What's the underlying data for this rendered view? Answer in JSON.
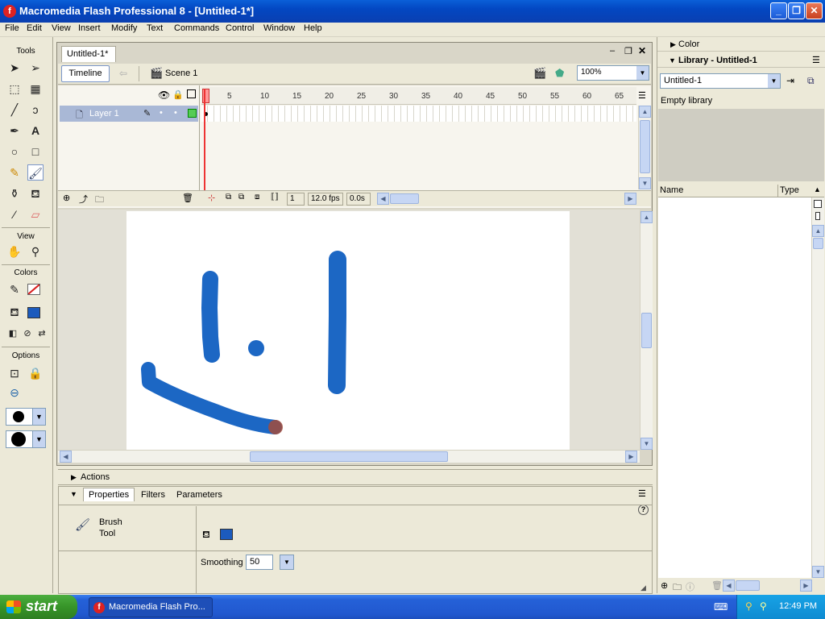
{
  "window": {
    "title": "Macromedia Flash Professional 8 - [Untitled-1*]",
    "app_icon": "flash-icon"
  },
  "menu": [
    "File",
    "Edit",
    "View",
    "Insert",
    "Modify",
    "Text",
    "Commands",
    "Control",
    "Window",
    "Help"
  ],
  "tools": {
    "title": "Tools",
    "sections": {
      "view": "View",
      "colors": "Colors",
      "options": "Options"
    },
    "stroke_color": "#d81e1e",
    "fill_color": "#1c5bbd"
  },
  "document": {
    "tab_label": "Untitled-1*",
    "timeline_button": "Timeline",
    "scene_label": "Scene 1",
    "zoom": "100%"
  },
  "timeline": {
    "layer_name": "Layer 1",
    "frame_ticks": [
      "1",
      "5",
      "10",
      "15",
      "20",
      "25",
      "30",
      "35",
      "40",
      "45",
      "50",
      "55",
      "60",
      "65"
    ],
    "current_frame": "1",
    "fps": "12.0 fps",
    "elapsed": "0.0s"
  },
  "stage": {
    "stroke_color": "#1c67c4"
  },
  "panels": {
    "actions": "Actions",
    "tabs": [
      "Properties",
      "Filters",
      "Parameters"
    ],
    "tool_name_line1": "Brush",
    "tool_name_line2": "Tool",
    "smoothing_label": "Smoothing",
    "smoothing_value": "50"
  },
  "right": {
    "color_panel": "Color",
    "library_panel": "Library - Untitled-1",
    "library_select": "Untitled-1",
    "empty_text": "Empty library",
    "col_name": "Name",
    "col_type": "Type"
  },
  "taskbar": {
    "start": "start",
    "item": "Macromedia Flash Pro...",
    "clock": "12:49 PM"
  }
}
